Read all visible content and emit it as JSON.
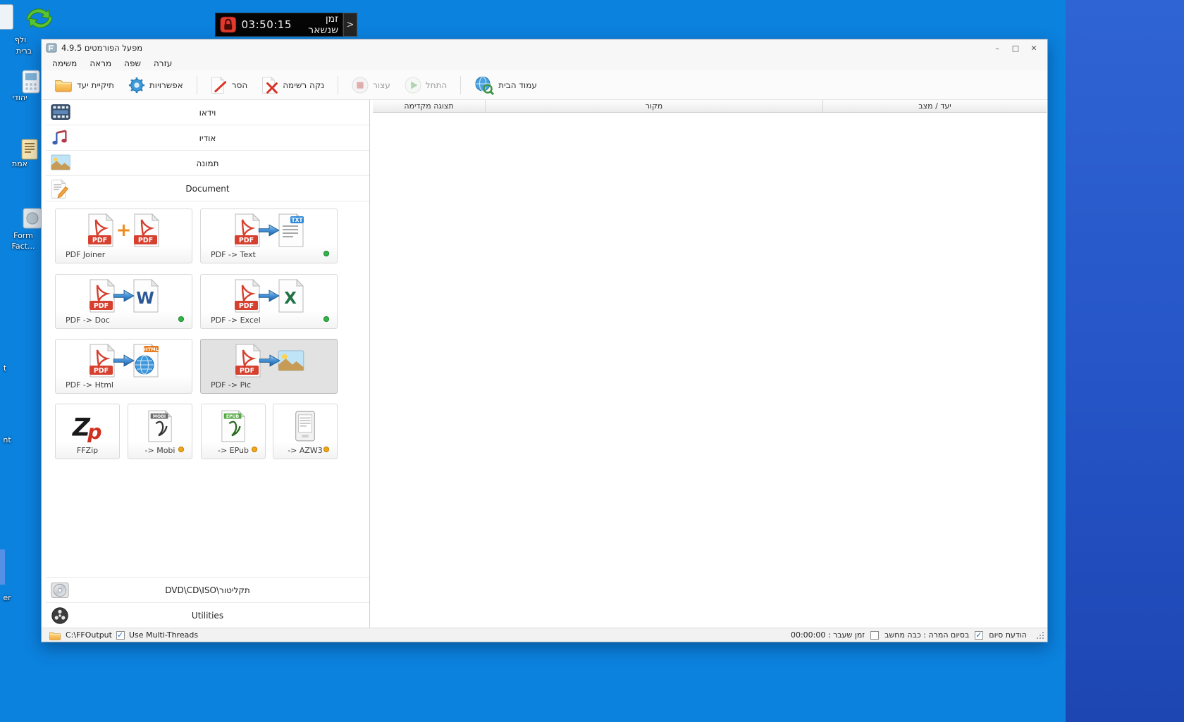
{
  "colors": {
    "desktop_blue": "#0b82de",
    "desktop_blue_dark": "#2554c6",
    "status_ready_green": "#35b44a",
    "status_partial_yellow": "#f2a71b",
    "timer_bg": "#050505",
    "timer_icon_red": "#e23a2e",
    "pdf_red": "#d6402f",
    "arrow_blue": "#3f8fd6"
  },
  "desktop": {
    "icons": [
      {
        "name": "sync-shortcut",
        "line1": "ולף",
        "line2": "ברית"
      },
      {
        "name": "device-shortcut",
        "line1": "יהודי",
        "line2": ""
      },
      {
        "name": "scroll-shortcut",
        "line1": "אמת",
        "line2": ""
      },
      {
        "name": "formfactory-shortcut",
        "line1": "Form",
        "line2": "Fact..."
      }
    ],
    "fragments": {
      "f1": "t",
      "f2": "nt",
      "f3": "er"
    }
  },
  "timer": {
    "time": "03:50:15",
    "label": "זמן שנשאר",
    "expand": ">"
  },
  "win": {
    "title": "מפעל הפורמטים 4.9.5",
    "controls": {
      "minimize": "–",
      "maximize": "□",
      "close": "✕"
    },
    "menu": {
      "task": "משימה",
      "view": "מראה",
      "language": "שפה",
      "help": "עזרה"
    },
    "toolbar": {
      "target_folder": "תיקיית יעד",
      "options": "אפשרויות",
      "remove": "הסר",
      "clear_list": "נקה רשימה",
      "stop": "עצור",
      "start": "התחל",
      "home": "עמוד הבית"
    },
    "categories": {
      "video": "וידאו",
      "audio": "אודיו",
      "picture": "תמונה",
      "document": "Document"
    },
    "plus": "+",
    "tiles": [
      {
        "label": "PDF Joiner",
        "status": "none",
        "selected": false
      },
      {
        "label": "PDF -> Text",
        "status": "green",
        "selected": false
      },
      {
        "label": "PDF -> Doc",
        "status": "green",
        "selected": false
      },
      {
        "label": "PDF -> Excel",
        "status": "green",
        "selected": false
      },
      {
        "label": "PDF -> Html",
        "status": "none",
        "selected": false
      },
      {
        "label": "PDF -> Pic",
        "status": "none",
        "selected": true
      }
    ],
    "small_tiles": [
      {
        "label": "FFZip",
        "status": "none"
      },
      {
        "label": "-> Mobi",
        "status": "yellow"
      },
      {
        "label": "-> EPub",
        "status": "yellow"
      },
      {
        "label": "-> AZW3",
        "status": "yellow"
      }
    ],
    "bottom_items": {
      "rom": "תקליטור\\DVD\\CD\\ISO",
      "utilities": "Utilities"
    },
    "table": {
      "col_preview": "תצוגה מקדימה",
      "col_source": "מקור",
      "col_target": "יעד / מצב"
    },
    "statusbar": {
      "output_path": "C:\\FFOutput",
      "multithreads": "Use Multi-Threads",
      "elapsed_label": "זמן שעבר : 00:00:00",
      "shutdown_label": "בסיום המרה : כבה מחשב",
      "notice_label": "הודעת סיום"
    }
  }
}
